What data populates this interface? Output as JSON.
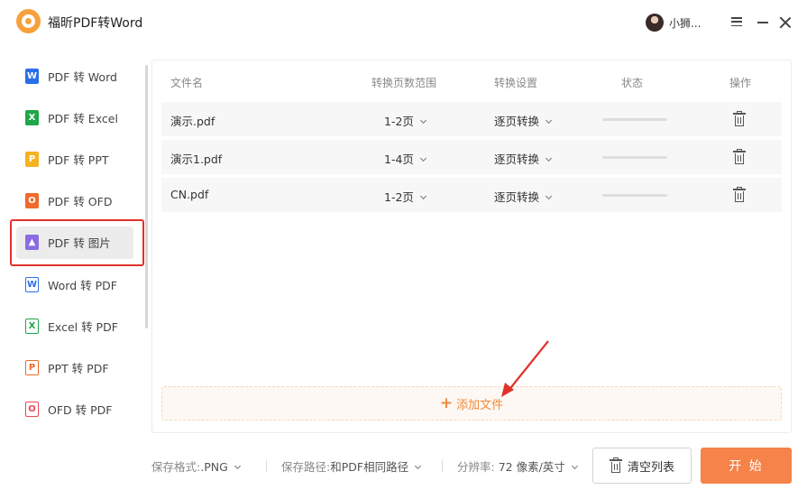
{
  "app": {
    "title": "福昕PDF转Word",
    "user_name": "小狮..."
  },
  "colors": {
    "accent": "#f5834a",
    "highlight_box": "#e0312b",
    "active_item_bg": "#ececec"
  },
  "sidebar": {
    "items": [
      {
        "label": "PDF 转 Word",
        "icon": "W",
        "icon_name": "word-icon",
        "color": "#2a6ee8",
        "style": "solid"
      },
      {
        "label": "PDF 转 Excel",
        "icon": "X",
        "icon_name": "excel-icon",
        "color": "#1fa74a",
        "style": "solid"
      },
      {
        "label": "PDF 转 PPT",
        "icon": "P",
        "icon_name": "ppt-icon",
        "color": "#f5b320",
        "style": "solid"
      },
      {
        "label": "PDF 转 OFD",
        "icon": "O",
        "icon_name": "ofd-icon",
        "color": "#f06a2a",
        "style": "solid"
      },
      {
        "label": "PDF 转 图片",
        "icon": "▲",
        "icon_name": "image-icon",
        "color": "#8b6be0",
        "style": "solid",
        "active": true
      },
      {
        "label": "Word 转 PDF",
        "icon": "W",
        "icon_name": "word-doc-icon",
        "color": "#2a6ee8",
        "style": "outline"
      },
      {
        "label": "Excel 转 PDF",
        "icon": "X",
        "icon_name": "excel-doc-icon",
        "color": "#1fa74a",
        "style": "outline"
      },
      {
        "label": "PPT 转 PDF",
        "icon": "P",
        "icon_name": "ppt-doc-icon",
        "color": "#f06a2a",
        "style": "outline"
      },
      {
        "label": "OFD 转 PDF",
        "icon": "O",
        "icon_name": "ofd-doc-icon",
        "color": "#e8485a",
        "style": "outline"
      }
    ]
  },
  "table": {
    "headers": {
      "name": "文件名",
      "range": "转换页数范围",
      "settings": "转换设置",
      "status": "状态",
      "action": "操作"
    },
    "rows": [
      {
        "name": "演示.pdf",
        "range": "1-2页",
        "setting": "逐页转换",
        "progress": 0
      },
      {
        "name": "演示1.pdf",
        "range": "1-4页",
        "setting": "逐页转换",
        "progress": 0
      },
      {
        "name": "CN.pdf",
        "range": "1-2页",
        "setting": "逐页转换",
        "progress": 0
      }
    ]
  },
  "add_files": {
    "label": "添加文件"
  },
  "bottom": {
    "format_label": "保存格式:",
    "format_value": ".PNG",
    "path_label": "保存路径:",
    "path_value": "和PDF相同路径",
    "resolution_label": "分辨率:",
    "resolution_value": "72 像素/英寸",
    "clear_label": "清空列表",
    "start_label": "开 始"
  }
}
